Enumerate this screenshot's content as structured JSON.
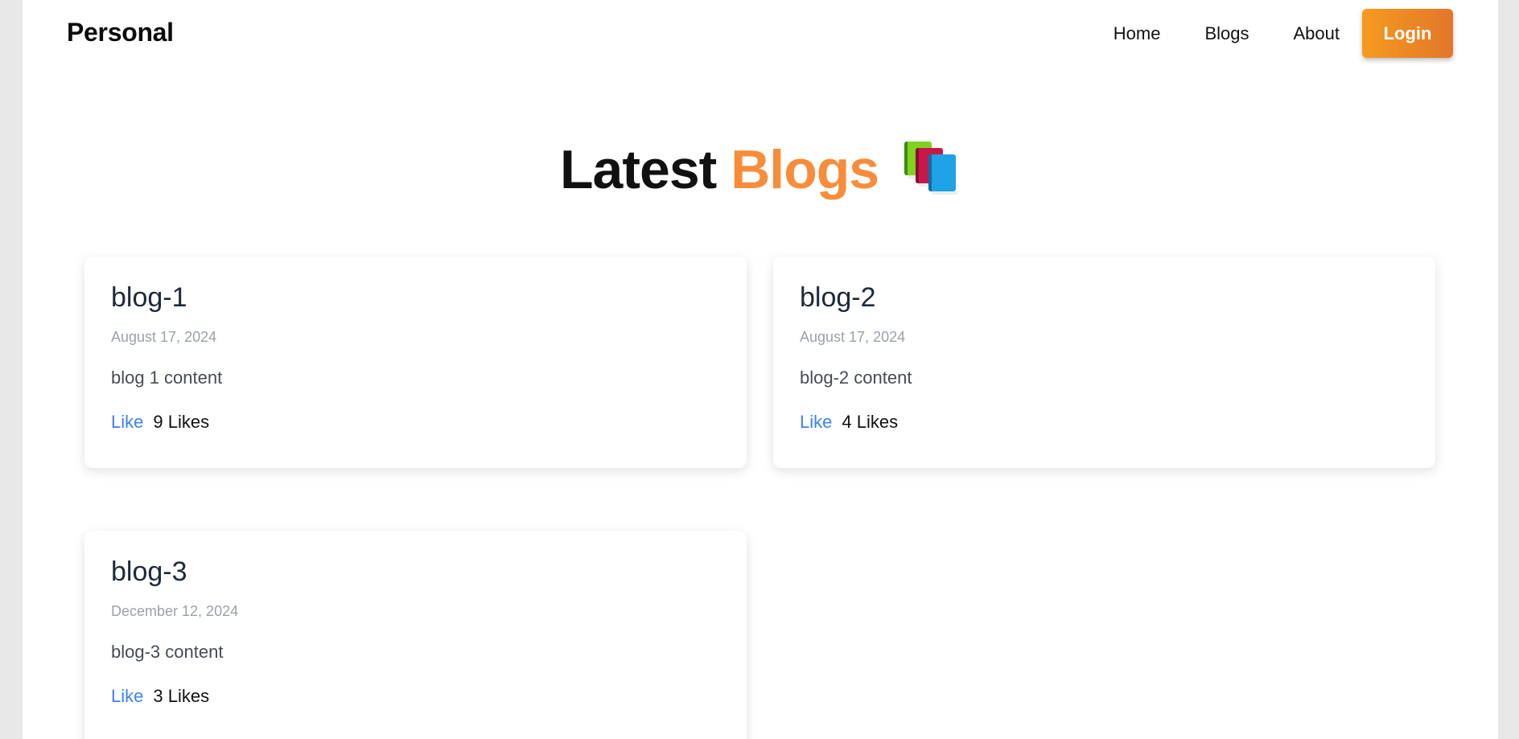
{
  "navbar": {
    "brand": "Personal",
    "links": [
      "Home",
      "Blogs",
      "About"
    ],
    "login_label": "Login"
  },
  "heading": {
    "word1": "Latest",
    "word2": "Blogs",
    "icon": "books-icon",
    "accent_color": "#f78d3a"
  },
  "blogs": [
    {
      "title": "blog-1",
      "date": "August 17, 2024",
      "content": "blog 1 content",
      "like_label": "Like",
      "likes": "9 Likes"
    },
    {
      "title": "blog-2",
      "date": "August 17, 2024",
      "content": "blog-2 content",
      "like_label": "Like",
      "likes": "4 Likes"
    },
    {
      "title": "blog-3",
      "date": "December 12, 2024",
      "content": "blog-3 content",
      "like_label": "Like",
      "likes": "3 Likes"
    }
  ],
  "colors": {
    "login_gradient_start": "#f59b1f",
    "login_gradient_end": "#e2772a",
    "like_link": "#3b82f6"
  }
}
